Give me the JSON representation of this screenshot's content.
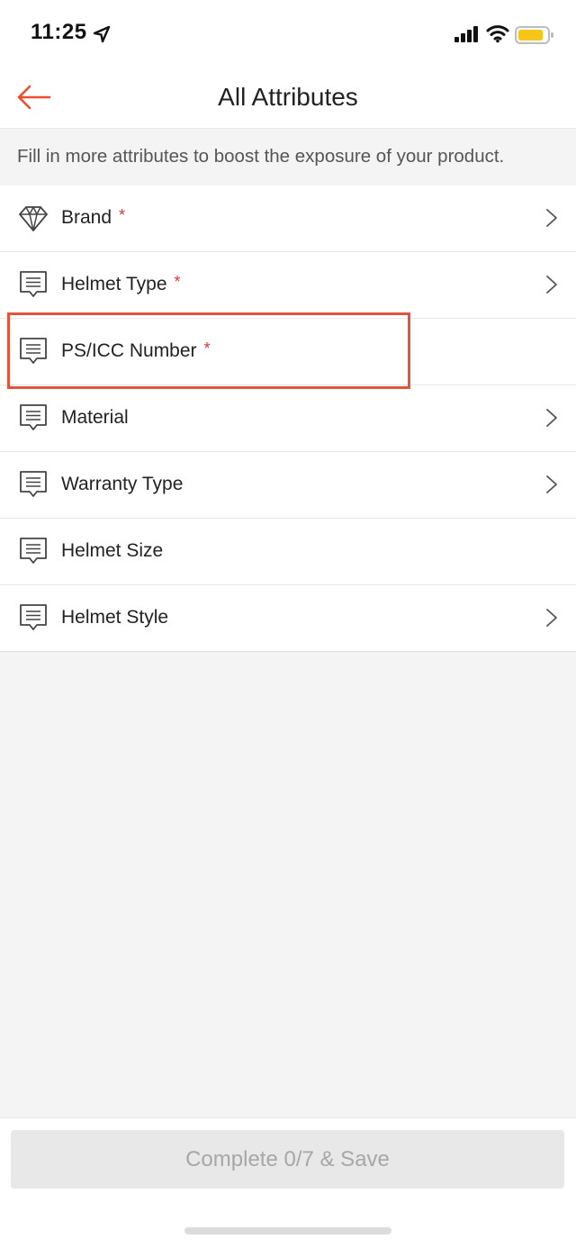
{
  "status_bar": {
    "time": "11:25",
    "icons": [
      "location-arrow-icon",
      "cellular-signal-icon",
      "wifi-icon",
      "battery-icon"
    ],
    "battery_color": "#f5c518"
  },
  "header": {
    "back_icon": "arrow-left-icon",
    "title": "All Attributes",
    "accent_color": "#ee4d2d"
  },
  "hint": {
    "text": "Fill in more attributes to boost the exposure of your product."
  },
  "attributes": [
    {
      "label": "Brand",
      "required": "*",
      "icon": "diamond-icon",
      "has_chevron": true
    },
    {
      "label": "Helmet Type",
      "required": "*",
      "icon": "message-icon",
      "has_chevron": true
    },
    {
      "label": "PS/ICC Number",
      "required": "*",
      "icon": "message-icon",
      "has_chevron": false
    },
    {
      "label": "Material",
      "required": "",
      "icon": "message-icon",
      "has_chevron": true
    },
    {
      "label": "Warranty Type",
      "required": "",
      "icon": "message-icon",
      "has_chevron": true
    },
    {
      "label": "Helmet Size",
      "required": "",
      "icon": "message-icon",
      "has_chevron": false
    },
    {
      "label": "Helmet Style",
      "required": "",
      "icon": "message-icon",
      "has_chevron": true
    }
  ],
  "highlight": {
    "target": "PS/ICC Number",
    "color": "#e4533a"
  },
  "footer": {
    "save_label": "Complete 0/7 & Save"
  },
  "colors": {
    "required": "#e0303a",
    "background": "#f4f4f4",
    "button_disabled_bg": "#e8e8e8",
    "button_disabled_text": "#a7a7a7"
  }
}
